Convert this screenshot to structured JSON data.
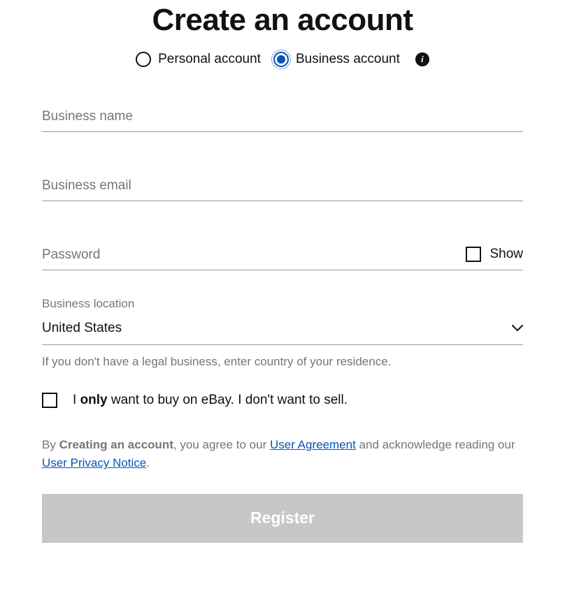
{
  "title": "Create an account",
  "account_types": {
    "personal": {
      "label": "Personal account",
      "selected": false
    },
    "business": {
      "label": "Business account",
      "selected": true
    }
  },
  "fields": {
    "business_name": {
      "placeholder": "Business name",
      "value": ""
    },
    "business_email": {
      "placeholder": "Business email",
      "value": ""
    },
    "password": {
      "placeholder": "Password",
      "value": "",
      "show_label": "Show",
      "show_checked": false
    },
    "business_location": {
      "label": "Business location",
      "selected": "United States",
      "hint": "If you don't have a legal business, enter country of your residence."
    }
  },
  "buy_only": {
    "checked": false,
    "text_prefix": "I ",
    "text_only": "only",
    "text_suffix": " want to buy on eBay. I don't want to sell."
  },
  "legal": {
    "prefix": "By ",
    "creating": "Creating an account",
    "mid1": ", you agree to our ",
    "user_agreement": "User Agreement",
    "mid2": " and acknowledge reading our ",
    "user_privacy": "User Privacy Notice",
    "suffix": "."
  },
  "register_label": "Register"
}
